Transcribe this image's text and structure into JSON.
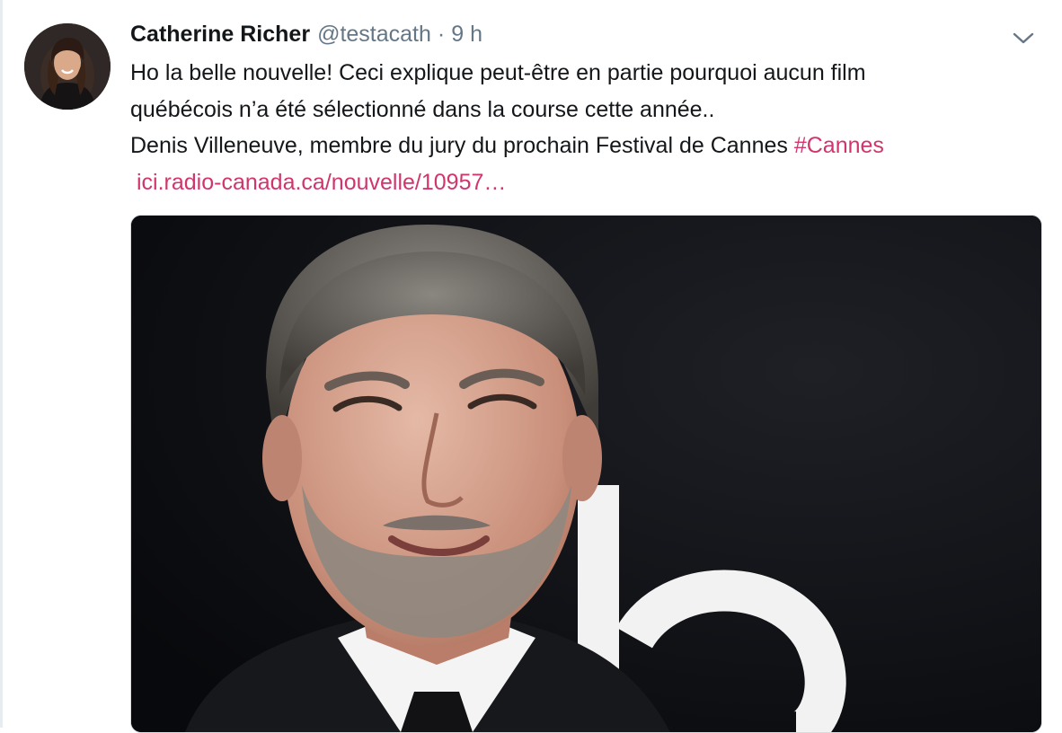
{
  "tweet": {
    "author_name": "Catherine Richer",
    "author_handle": "@testacath",
    "separator": "·",
    "timestamp": "9 h",
    "text_line1": "Ho la belle nouvelle! Ceci explique peut-être en partie pourquoi aucun film",
    "text_line2": "québécois n’a été sélectionné dans la course cette année..",
    "text_line3": "Denis Villeneuve, membre du jury du prochain Festival de Cannes",
    "hashtag": "#Cannes",
    "link": "ici.radio-canada.ca/nouvelle/10957…"
  },
  "icons": {
    "menu": "chevron-down-icon"
  },
  "colors": {
    "link": "#d0356d",
    "text": "#14171a",
    "secondary": "#657786",
    "border": "#d4dde3"
  }
}
